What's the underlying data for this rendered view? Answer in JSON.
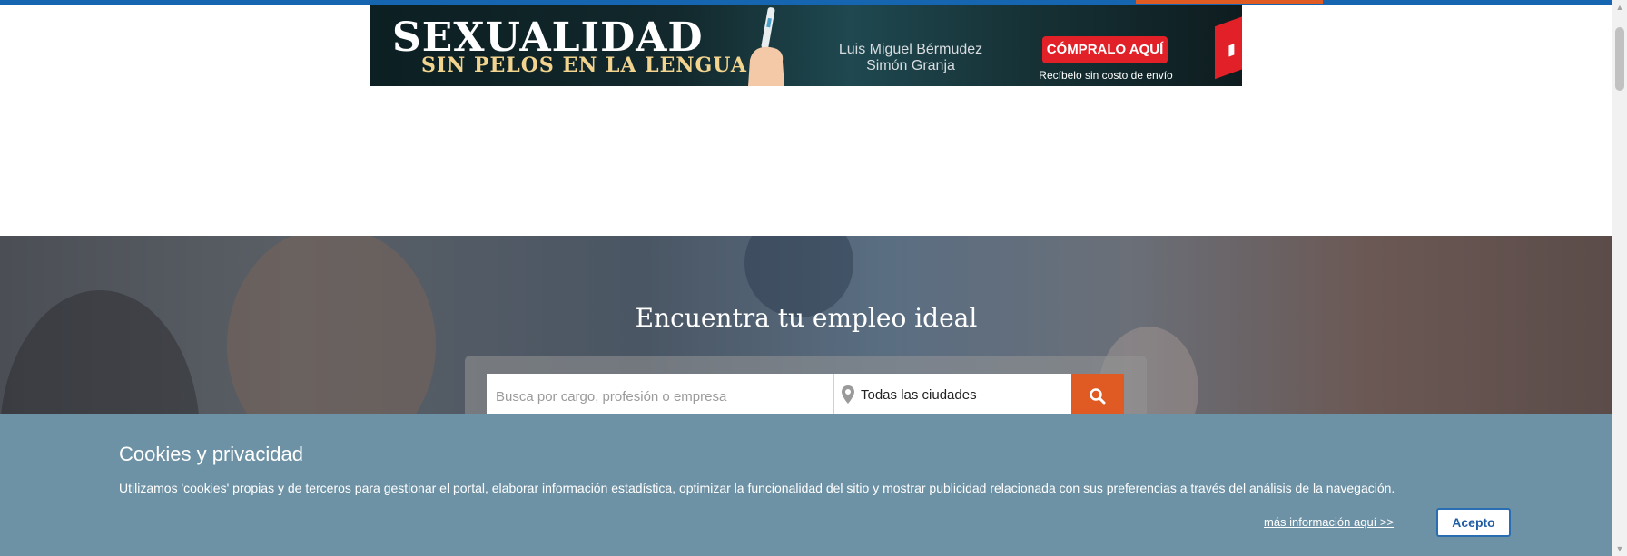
{
  "ad": {
    "title_line1": "SEXUALIDAD",
    "title_line2": "SIN PELOS EN LA LENGUA",
    "author1": "Luis Miguel Bérmudez",
    "author2": "Simón Granja",
    "buy_button": "CÓMPRALO AQUÍ",
    "shipping": "Recíbelo sin costo de envío"
  },
  "hero": {
    "title": "Encuentra tu empleo ideal",
    "search_placeholder": "Busca por cargo, profesión o empresa",
    "city_selected": "Todas las ciudades"
  },
  "cookies": {
    "title": "Cookies y privacidad",
    "message": "Utilizamos 'cookies' propias y de terceros para gestionar el portal, elaborar información estadística, optimizar la funcionalidad del sitio y mostrar publicidad relacionada con sus preferencias a través del análisis de la navegación.",
    "more_link": "más información aquí >>",
    "accept_button": "Acepto"
  },
  "colors": {
    "brand_blue": "#1565b0",
    "accent_orange": "#e05a24",
    "cookie_bg": "#6e92a5",
    "ad_red": "#e22027"
  },
  "icons": [
    "location-pin-icon",
    "search-icon",
    "scroll-up-arrow-icon",
    "scroll-down-arrow-icon"
  ]
}
